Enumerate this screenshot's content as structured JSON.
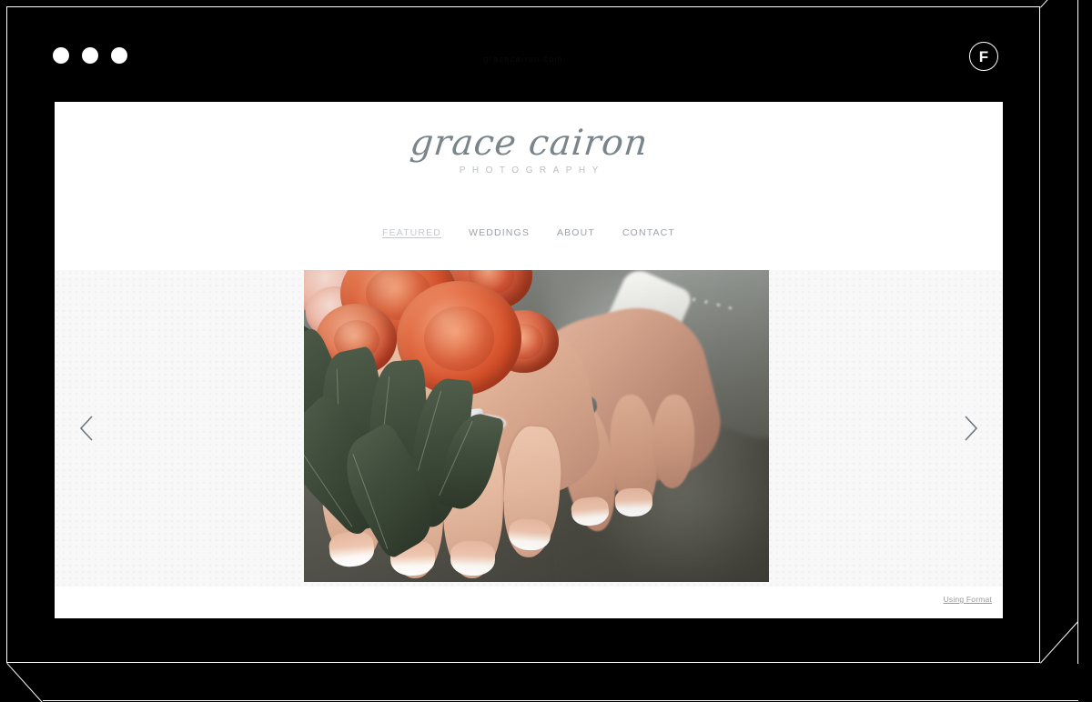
{
  "browser": {
    "address_text": "gracecairon.com",
    "window_controls": [
      "close",
      "minimize",
      "maximize"
    ],
    "format_badge_label": "F",
    "chrome_color": "#000000"
  },
  "site": {
    "logo": {
      "script_name": "grace cairon",
      "subtitle": "PHOTOGRAPHY",
      "script_color": "#79858a",
      "subtitle_color": "#b9c0c4"
    },
    "nav": {
      "items": [
        {
          "label": "FEATURED",
          "active": true
        },
        {
          "label": "WEDDINGS",
          "active": false
        },
        {
          "label": "ABOUT",
          "active": false
        },
        {
          "label": "CONTACT",
          "active": false
        }
      ],
      "active_color": "#c3c9d2",
      "inactive_color": "#9aa3ab"
    },
    "slider": {
      "prev_label": "Previous slide",
      "next_label": "Next slide",
      "background_color": "#f8f8f9",
      "image_alt": "Bride and groom hands with wedding rings resting beside an orange rose bouquet"
    },
    "footer": {
      "credit_label": "Using Format",
      "credit_color": "#9a9a9a"
    }
  }
}
